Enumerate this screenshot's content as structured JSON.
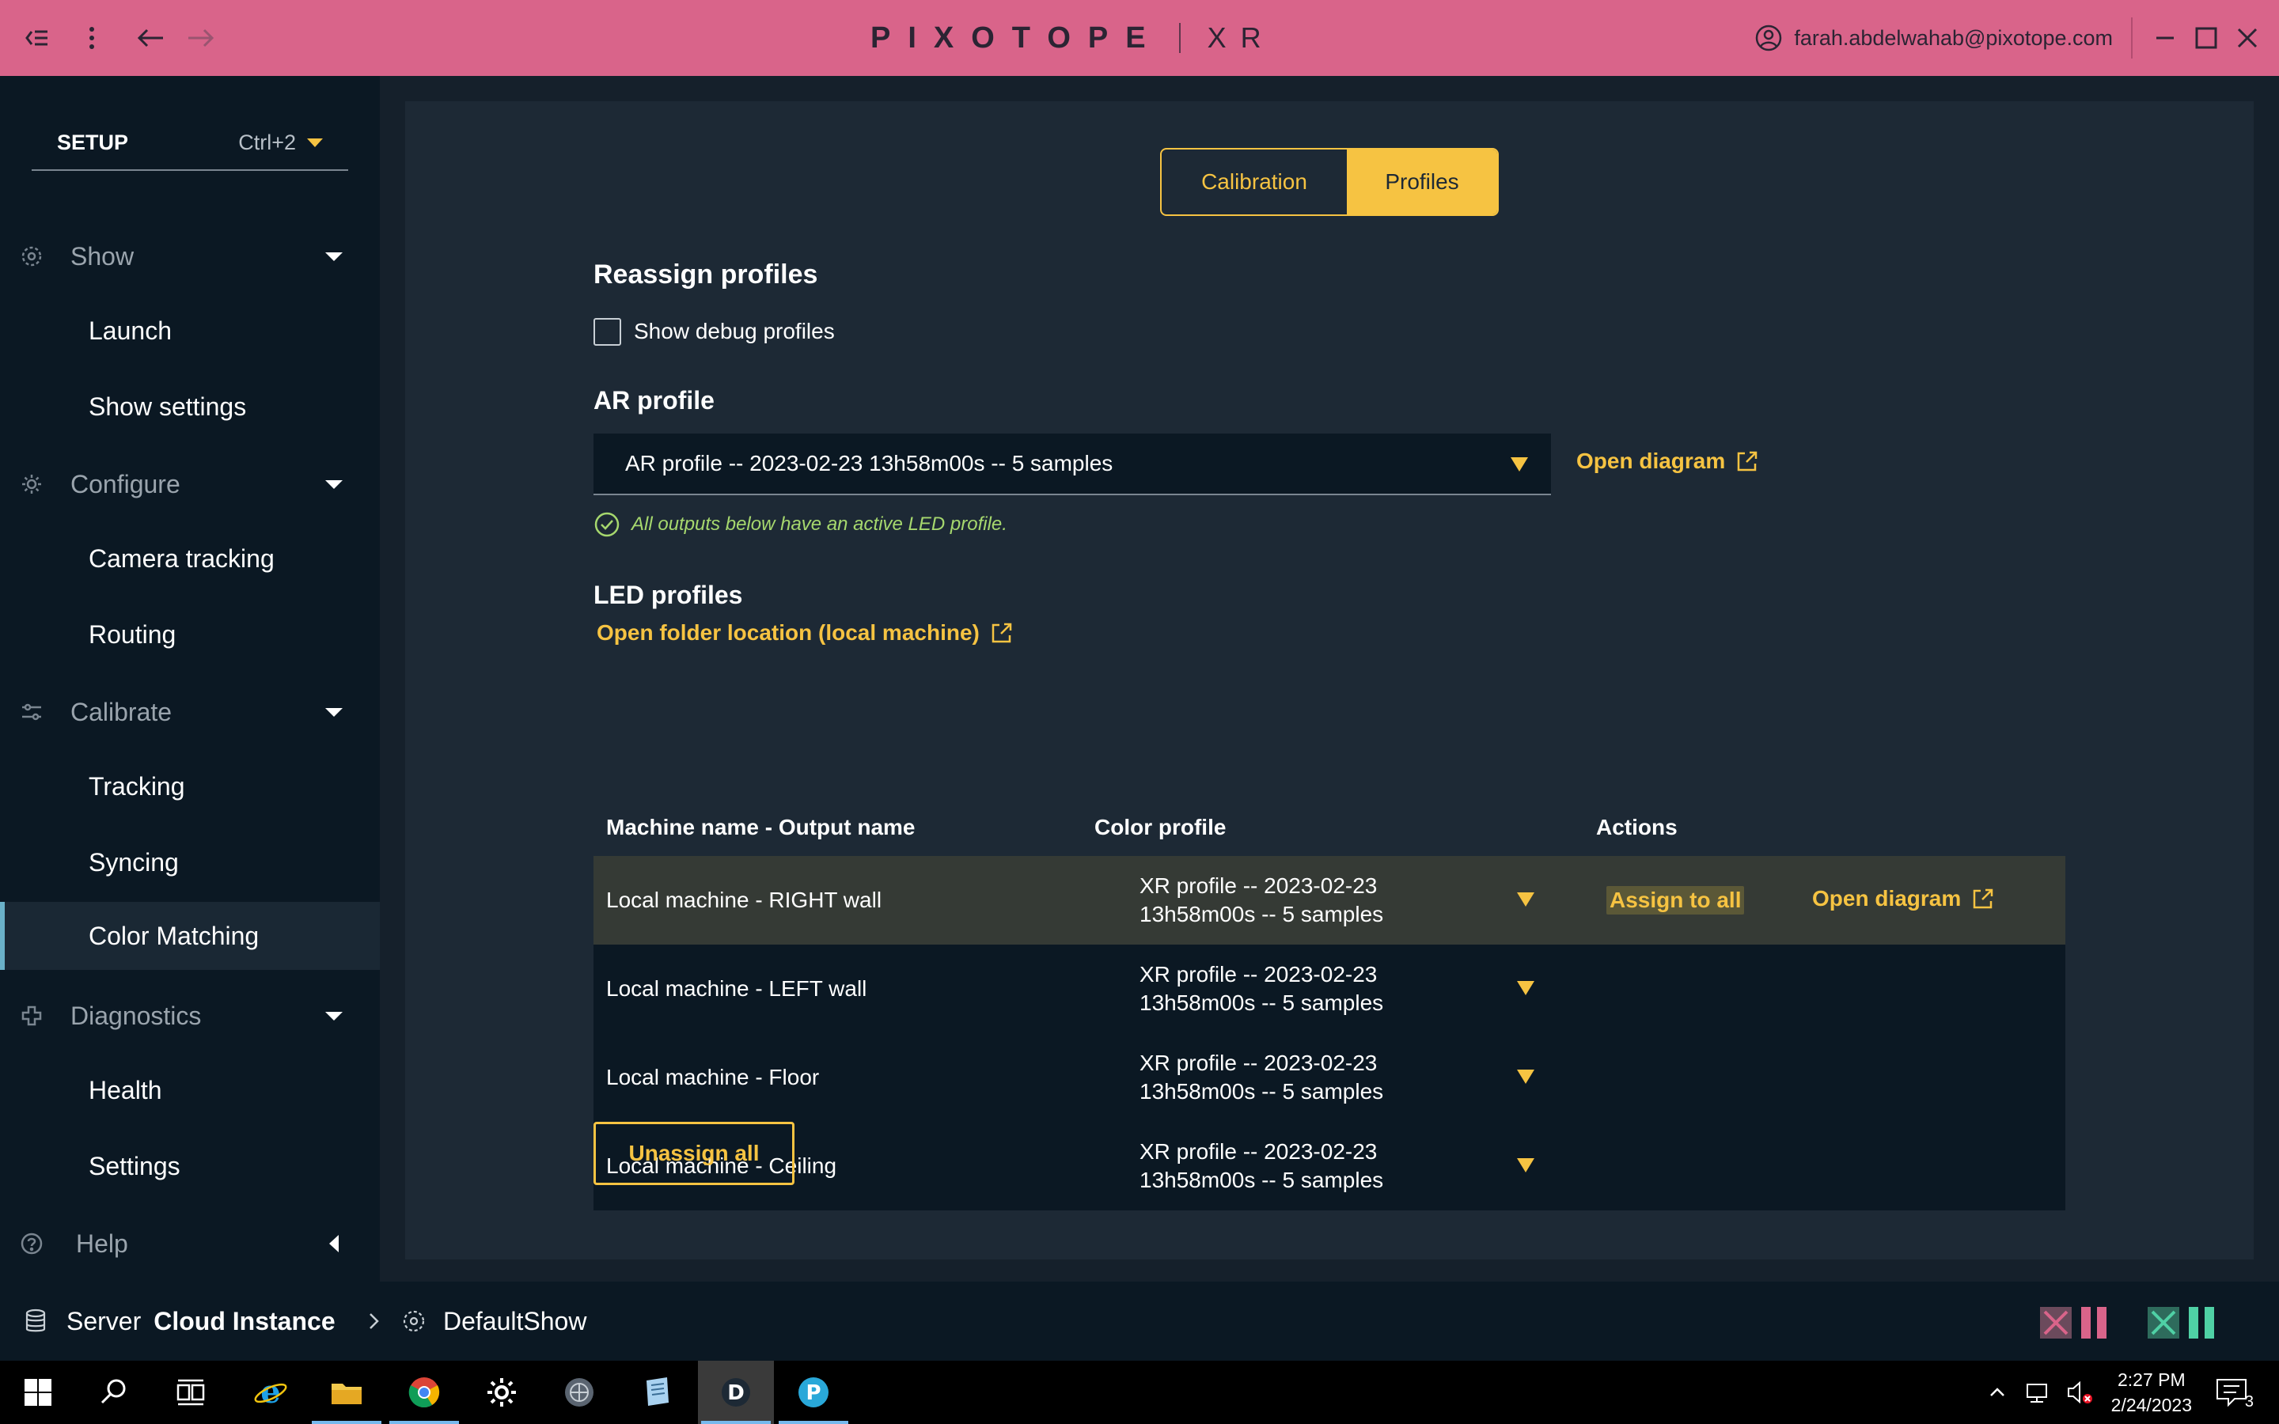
{
  "titlebar": {
    "brand_name": "PIXOTOPE",
    "brand_product": "XR",
    "user_email": "farah.abdelwahab@pixotope.com",
    "icons": [
      "collapse-sidebar-icon",
      "more-vertical-icon",
      "back-arrow-icon",
      "forward-arrow-icon",
      "user-icon",
      "minimize-icon",
      "maximize-icon",
      "close-icon"
    ]
  },
  "sidebar": {
    "mode_label": "SETUP",
    "mode_shortcut": "Ctrl+2",
    "sections": [
      {
        "label": "Show",
        "icon": "show-icon",
        "items": [
          "Launch",
          "Show settings"
        ]
      },
      {
        "label": "Configure",
        "icon": "gear-icon",
        "items": [
          "Camera tracking",
          "Routing"
        ]
      },
      {
        "label": "Calibrate",
        "icon": "sliders-icon",
        "items": [
          "Tracking",
          "Syncing",
          "Color Matching"
        ]
      },
      {
        "label": "Diagnostics",
        "icon": "diagnostics-icon",
        "items": [
          "Health",
          "Settings"
        ]
      },
      {
        "label": "Help",
        "icon": "help-icon",
        "items": []
      }
    ],
    "active_item": "Color Matching"
  },
  "main": {
    "tabs": [
      {
        "label": "Calibration",
        "selected": false
      },
      {
        "label": "Profiles",
        "selected": true
      }
    ],
    "reassign_title": "Reassign profiles",
    "debug_checkbox_label": "Show debug profiles",
    "debug_checked": false,
    "ar_title": "AR profile",
    "ar_selected": "AR profile -- 2023-02-23 13h58m00s -- 5 samples",
    "open_diagram_label": "Open diagram",
    "status_message": "All outputs below have an active LED profile.",
    "led_title": "LED profiles",
    "open_folder_label": "Open folder location (local machine)",
    "table": {
      "headers": [
        "Machine name - Output name",
        "Color profile",
        "Actions"
      ],
      "rows": [
        {
          "name": "Local machine - RIGHT wall",
          "profile_line1": "XR profile -- 2023-02-23",
          "profile_line2": "13h58m00s -- 5 samples",
          "selected": true
        },
        {
          "name": "Local machine - LEFT wall",
          "profile_line1": "XR profile -- 2023-02-23",
          "profile_line2": "13h58m00s -- 5 samples",
          "selected": false
        },
        {
          "name": "Local machine - Floor",
          "profile_line1": "XR profile -- 2023-02-23",
          "profile_line2": "13h58m00s -- 5 samples",
          "selected": false
        },
        {
          "name": "Local machine - Ceiling",
          "profile_line1": "XR profile -- 2023-02-23",
          "profile_line2": "13h58m00s -- 5 samples",
          "selected": false
        }
      ],
      "assign_all_label": "Assign to all",
      "row_open_diagram_label": "Open diagram"
    },
    "unassign_all_label": "Unassign all"
  },
  "statusbar": {
    "server_label": "Server",
    "server_name": "Cloud Instance",
    "show_name": "DefaultShow"
  },
  "taskbar": {
    "time": "2:27 PM",
    "date": "2/24/2023",
    "notification_count": "3"
  },
  "colors": {
    "accent": "#f6c342",
    "titlebar": "#d9648a",
    "sidebar_bg": "#0b1823",
    "panel_bg": "#1d2935",
    "success": "#a6d86e"
  }
}
